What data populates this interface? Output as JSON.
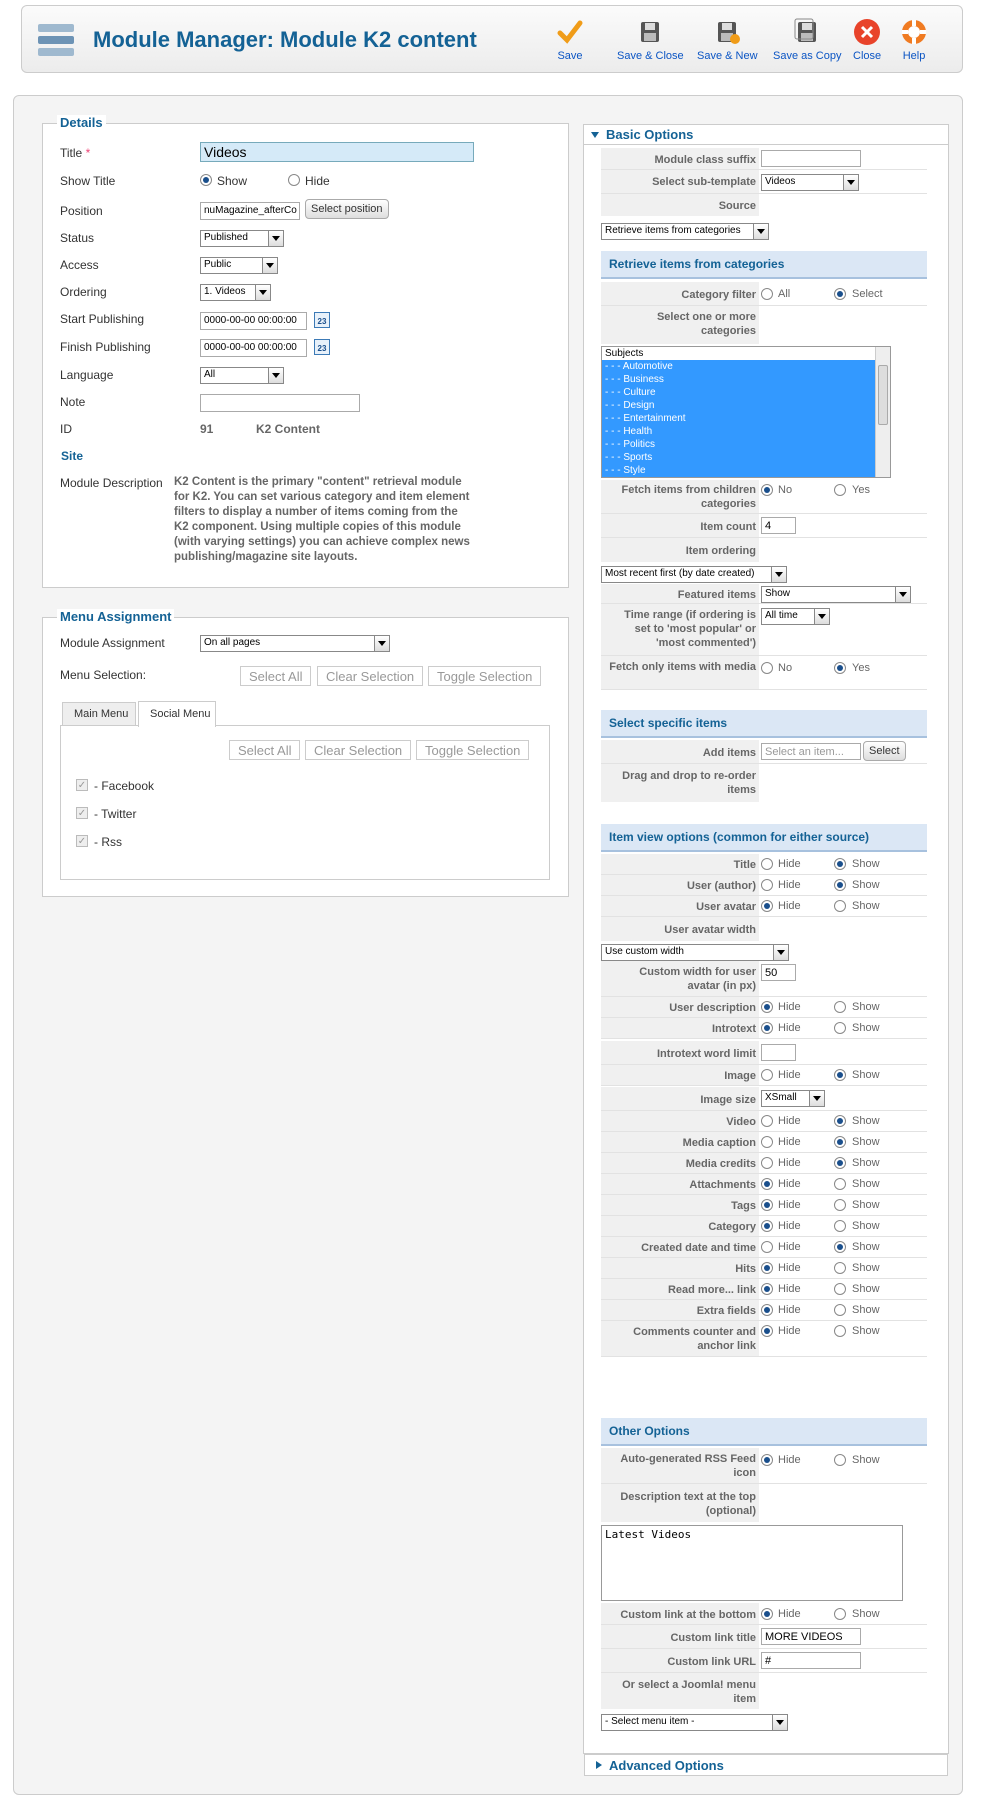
{
  "header": {
    "title": "Module Manager: Module K2 content",
    "icon": "module-manager-icon"
  },
  "toolbar": [
    {
      "label": "Save",
      "icon": "save-check-icon",
      "color": "#f09c18"
    },
    {
      "label": "Save & Close",
      "icon": "save-disk-icon"
    },
    {
      "label": "Save & New",
      "icon": "save-new-icon"
    },
    {
      "label": "Save as Copy",
      "icon": "save-copy-icon"
    },
    {
      "label": "Close",
      "icon": "close-icon",
      "color": "#e8432a"
    },
    {
      "label": "Help",
      "icon": "help-lifebuoy-icon",
      "color": "#f07b22"
    }
  ],
  "details": {
    "legend": "Details",
    "title_label": "Title",
    "title_req": "*",
    "title_value": "Videos",
    "show_title_label": "Show Title",
    "show": "Show",
    "hide": "Hide",
    "position_label": "Position",
    "position_value": "nuMagazine_afterCo",
    "select_position": "Select position",
    "status_label": "Status",
    "status_value": "Published",
    "access_label": "Access",
    "access_value": "Public",
    "ordering_label": "Ordering",
    "ordering_value": "1. Videos",
    "start_label": "Start Publishing",
    "start_value": "0000-00-00 00:00:00",
    "finish_label": "Finish Publishing",
    "finish_value": "0000-00-00 00:00:00",
    "calendar": "23",
    "language_label": "Language",
    "language_value": "All",
    "note_label": "Note",
    "id_label": "ID",
    "id_value": "91",
    "id_type": "K2 Content",
    "site_label": "Site",
    "module_desc_label": "Module Description",
    "module_desc": "K2 Content is the primary \"content\" retrieval module for K2. You can set various category and item element filters to display a number of items coming from the K2 component. Using multiple copies of this module (with varying settings) you can achieve complex news publishing/magazine site layouts."
  },
  "menu": {
    "legend": "Menu Assignment",
    "assignment_label": "Module Assignment",
    "assignment_value": "On all pages",
    "selection_label": "Menu Selection:",
    "select_all": "Select All",
    "clear_selection": "Clear Selection",
    "toggle_selection": "Toggle Selection",
    "tabs": [
      "Main Menu",
      "Social Menu"
    ],
    "items": [
      "- Facebook",
      "- Twitter",
      "- Rss"
    ],
    "check": "✓"
  },
  "basic": {
    "title": "Basic Options",
    "class_suffix_label": "Module class suffix",
    "subtemplate_label": "Select sub-template",
    "subtemplate_value": "Videos",
    "source_label": "Source",
    "source_value": "Retrieve items from categories",
    "retrieve_head": "Retrieve items from categories",
    "category_filter_label": "Category filter",
    "all": "All",
    "select": "Select",
    "select_categories_label": "Select one or more categories",
    "categories": [
      "Subjects",
      "- - - Automotive",
      "- - - Business",
      "- - - Culture",
      "- - - Design",
      "- - - Entertainment",
      "- - - Health",
      "- - - Politics",
      "- - - Sports",
      "- - - Style"
    ],
    "fetch_children_label": "Fetch items from children categories",
    "no": "No",
    "yes": "Yes",
    "item_count_label": "Item count",
    "item_count_value": "4",
    "item_ordering_label": "Item ordering",
    "item_ordering_value": "Most recent first (by date created)",
    "featured_label": "Featured items",
    "featured_value": "Show",
    "time_range_label": "Time range (if ordering is set to 'most popular' or 'most commented')",
    "time_range_value": "All time",
    "fetch_media_label": "Fetch only items with media",
    "specific_head": "Select specific items",
    "add_items_label": "Add items",
    "add_items_placeholder": "Select an item...",
    "select_btn": "Select",
    "drag_label": "Drag and drop to re-order items",
    "view_head": "Item view options (common for either source)",
    "hide": "Hide",
    "show": "Show",
    "avatar_width_label": "User avatar width",
    "avatar_width_value": "Use custom width",
    "custom_width_label": "Custom width for user avatar (in px)",
    "custom_width_value": "50",
    "introtext_limit_label": "Introtext word limit",
    "image_size_label": "Image size",
    "image_size_value": "XSmall",
    "other_head": "Other Options",
    "rss_label": "Auto-generated RSS Feed icon",
    "desc_top_label": "Description text at the top (optional)",
    "desc_top_value": "Latest Videos",
    "custom_link_label": "Custom link at the bottom",
    "link_title_label": "Custom link title",
    "link_title_value": "MORE VIDEOS",
    "link_url_label": "Custom link URL",
    "link_url_value": "#",
    "joomla_menu_label": "Or select a Joomla! menu item",
    "joomla_menu_value": "- Select menu item -"
  },
  "view_rows1": [
    {
      "label": "Title",
      "sel": "show"
    },
    {
      "label": "User (author)",
      "sel": "show"
    },
    {
      "label": "User avatar",
      "sel": "hide"
    }
  ],
  "view_rows2": [
    {
      "label": "User description",
      "sel": "hide"
    },
    {
      "label": "Introtext",
      "sel": "hide"
    }
  ],
  "view_rows3": [
    {
      "label": "Video",
      "sel": "show"
    },
    {
      "label": "Media caption",
      "sel": "show"
    },
    {
      "label": "Media credits",
      "sel": "show"
    },
    {
      "label": "Attachments",
      "sel": "hide"
    },
    {
      "label": "Tags",
      "sel": "hide"
    },
    {
      "label": "Category",
      "sel": "hide"
    },
    {
      "label": "Created date and time",
      "sel": "show"
    },
    {
      "label": "Hits",
      "sel": "hide"
    },
    {
      "label": "Read more... link",
      "sel": "hide"
    },
    {
      "label": "Extra fields",
      "sel": "hide"
    },
    {
      "label": "Comments counter and anchor link",
      "sel": "hide"
    }
  ],
  "image_row": {
    "label": "Image",
    "sel": "show"
  },
  "advanced": {
    "title": "Advanced Options"
  }
}
